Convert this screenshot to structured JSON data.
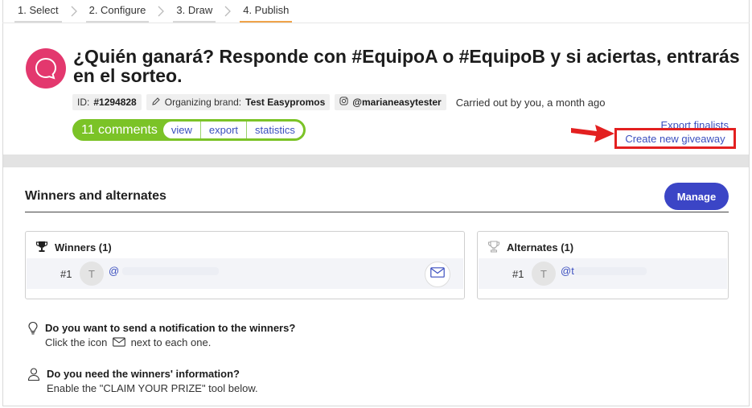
{
  "steps": [
    {
      "label": "1. Select"
    },
    {
      "label": "2. Configure"
    },
    {
      "label": "3. Draw"
    },
    {
      "label": "4. Publish"
    }
  ],
  "header": {
    "title": "¿Quién ganará? Responde con #EquipoA o #EquipoB y si aciertas, entrarás en el sorteo.",
    "id_label": "ID:",
    "id_value": "#1294828",
    "brand_label": "Organizing brand:",
    "brand_value": "Test Easypromos",
    "instagram_handle": "@marianeasytester",
    "carried_out": "Carried out by you, a month ago"
  },
  "comments": {
    "count_label": "11 comments",
    "view": "view",
    "export": "export",
    "statistics": "statistics"
  },
  "actions": {
    "export_finalists": "Export finalists",
    "create_new": "Create new giveaway"
  },
  "winners_section": {
    "title": "Winners and alternates",
    "manage": "Manage",
    "winners_title": "Winners (1)",
    "alternates_title": "Alternates (1)",
    "winner": {
      "num": "#1",
      "initial": "T",
      "handle": "@"
    },
    "alternate": {
      "num": "#1",
      "initial": "T",
      "handle": "@t"
    }
  },
  "info": {
    "notify_q": "Do you want to send a notification to the winners?",
    "notify_a1": "Click the icon",
    "notify_a2": "next to each one.",
    "claim_q": "Do you need the winners' information?",
    "claim_a": "Enable the \"CLAIM YOUR PRIZE\" tool below."
  },
  "colors": {
    "accent_blue": "#3b45c6",
    "link_blue": "#3b4fbf",
    "green": "#7bc327",
    "pink": "#e3386e",
    "red": "#e32020",
    "step_active": "#f0a34a"
  }
}
